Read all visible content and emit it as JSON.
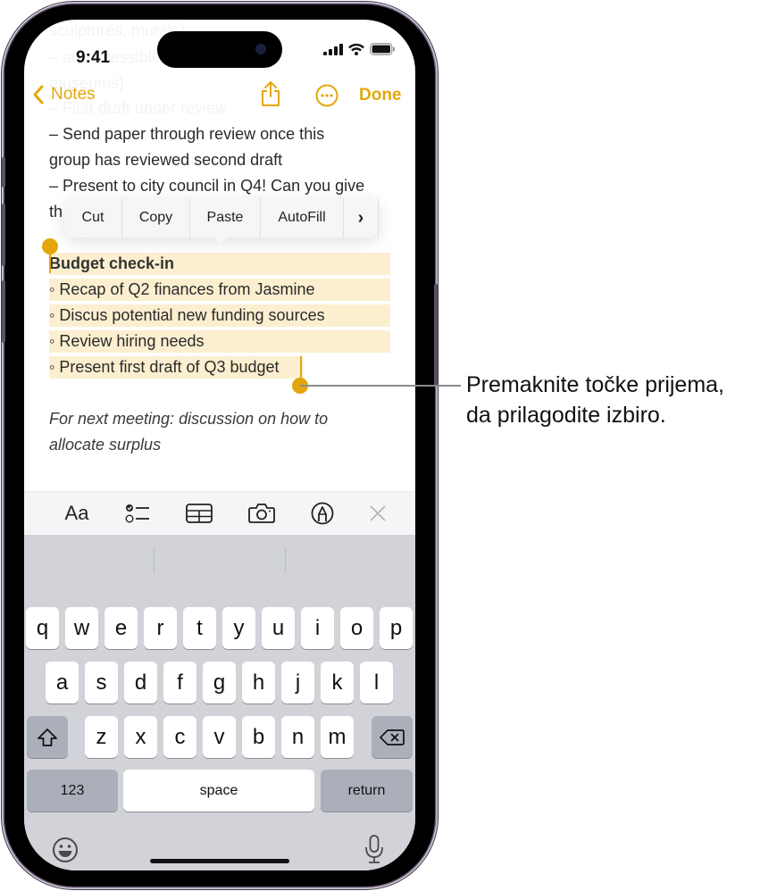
{
  "status_bar": {
    "time": "9:41"
  },
  "background_text": [
    "sculptures, murals)",
    "– art accessible to all (free",
    "museums)",
    "– First draft under review"
  ],
  "nav": {
    "back_label": "Notes",
    "done_label": "Done",
    "accent_color": "#e3a70c"
  },
  "note": {
    "lines_before": [
      "– Send paper through review once this",
      "group has reviewed second draft",
      "– Present to city council in Q4! Can you give",
      "th"
    ],
    "selected": {
      "heading": "Budget check-in",
      "bullets": [
        "Recap of Q2 finances from Jasmine",
        "Discus potential new funding sources",
        "Review hiring needs",
        "Present first draft of Q3 budget"
      ],
      "bullet_glyph": "◦",
      "highlight_color": "#fbefd0"
    },
    "italic_lines": [
      "For next meeting: discussion on how to",
      "allocate surplus"
    ]
  },
  "edit_menu": {
    "items": [
      "Cut",
      "Copy",
      "Paste",
      "AutoFill"
    ],
    "more_label": "›"
  },
  "format_toolbar": {
    "items": [
      "text-format",
      "checklist",
      "table",
      "camera",
      "markup",
      "close"
    ],
    "text_format_label": "Aa"
  },
  "keyboard": {
    "row1": [
      "q",
      "w",
      "e",
      "r",
      "t",
      "y",
      "u",
      "i",
      "o",
      "p"
    ],
    "row2": [
      "a",
      "s",
      "d",
      "f",
      "g",
      "h",
      "j",
      "k",
      "l"
    ],
    "row3": [
      "z",
      "x",
      "c",
      "v",
      "b",
      "n",
      "m"
    ],
    "numbers_label": "123",
    "space_label": "space",
    "return_label": "return"
  },
  "callout": {
    "line1": "Premaknite točke prijema,",
    "line2": "da prilagodite izbiro."
  }
}
